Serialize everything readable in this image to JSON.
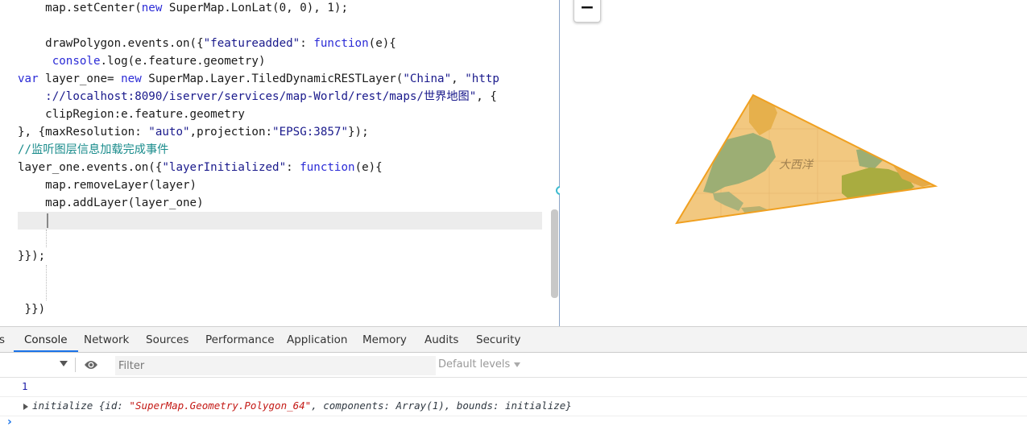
{
  "editor": {
    "lines": [
      [
        {
          "t": "    map.setCenter("
        },
        {
          "t": "new",
          "c": "kw"
        },
        {
          "t": " SuperMap.LonLat(0, 0), 1);"
        }
      ],
      [],
      [
        {
          "t": "    drawPolygon.events.on({"
        },
        {
          "t": "\"featureadded\"",
          "c": "str"
        },
        {
          "t": ": "
        },
        {
          "t": "function",
          "c": "kw"
        },
        {
          "t": "(e){"
        }
      ],
      [
        {
          "t": "     "
        },
        {
          "t": "console",
          "c": "kw"
        },
        {
          "t": ".log(e.feature.geometry)"
        }
      ],
      [
        {
          "t": "var",
          "c": "kw"
        },
        {
          "t": " layer_one= "
        },
        {
          "t": "new",
          "c": "kw"
        },
        {
          "t": " SuperMap.Layer.TiledDynamicRESTLayer("
        },
        {
          "t": "\"China\"",
          "c": "str"
        },
        {
          "t": ", "
        },
        {
          "t": "\"http",
          "c": "str"
        }
      ],
      [
        {
          "t": "    ://localhost:8090/iserver/services/map-World/rest/maps/世界地图\"",
          "c": "str"
        },
        {
          "t": ", {"
        }
      ],
      [
        {
          "t": "    clipRegion:e.feature.geometry"
        }
      ],
      [
        {
          "t": "}, {maxResolution: "
        },
        {
          "t": "\"auto\"",
          "c": "str"
        },
        {
          "t": ",projection:"
        },
        {
          "t": "\"EPSG:3857\"",
          "c": "str"
        },
        {
          "t": "});"
        }
      ],
      [
        {
          "t": "//监听图层信息加载完成事件",
          "c": "cmt"
        }
      ],
      [
        {
          "t": "layer_one.events.on({"
        },
        {
          "t": "\"layerInitialized\"",
          "c": "str"
        },
        {
          "t": ": "
        },
        {
          "t": "function",
          "c": "kw"
        },
        {
          "t": "(e){"
        }
      ],
      [
        {
          "t": "    map.removeLayer(layer)"
        }
      ],
      [
        {
          "t": "    map.addLayer(layer_one)"
        }
      ],
      [],
      [],
      [
        {
          "t": "}});"
        }
      ],
      [],
      [],
      [
        {
          "t": " }})"
        }
      ]
    ]
  },
  "map": {
    "zoom_out_label": "−",
    "ocean_label": "大西洋",
    "polygon_stroke": "#f0a020",
    "polygon_fill": "#f2c880"
  },
  "devtools": {
    "tabs": [
      {
        "label": "s",
        "active": false
      },
      {
        "label": "Console",
        "active": true
      },
      {
        "label": "Network",
        "active": false
      },
      {
        "label": "Sources",
        "active": false
      },
      {
        "label": "Performance",
        "active": false
      },
      {
        "label": "Application",
        "active": false
      },
      {
        "label": "Memory",
        "active": false
      },
      {
        "label": "Audits",
        "active": false
      },
      {
        "label": "Security",
        "active": false
      }
    ],
    "filter_placeholder": "Filter",
    "levels_label": "Default levels",
    "console": {
      "log_value": "1",
      "object_prefix": "initialize {id: ",
      "object_id": "\"SuperMap.Geometry.Polygon_64\"",
      "object_suffix": ", components: Array(1), bounds: initialize}",
      "prompt_symbol": "›"
    },
    "accent_color": "#1a73e8"
  }
}
